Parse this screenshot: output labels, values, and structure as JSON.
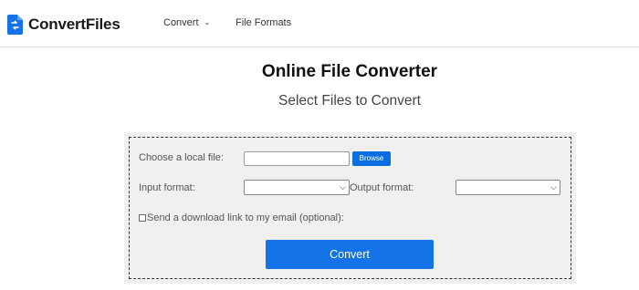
{
  "brand": {
    "name": "ConvertFiles",
    "icon": "document-convert-icon",
    "color": "#1473e6"
  },
  "nav": {
    "convert_label": "Convert",
    "formats_label": "File Formats"
  },
  "header": {
    "title": "Online File Converter",
    "subtitle": "Select Files to Convert"
  },
  "form": {
    "file_label": "Choose a local file:",
    "browse_label": "Browse",
    "input_format_label": "Input format:",
    "input_format_value": "",
    "output_format_label": "Output format:",
    "output_format_value": "",
    "email_label": "Send a download link to my email (optional):",
    "email_checked": false,
    "convert_label": "Convert"
  }
}
